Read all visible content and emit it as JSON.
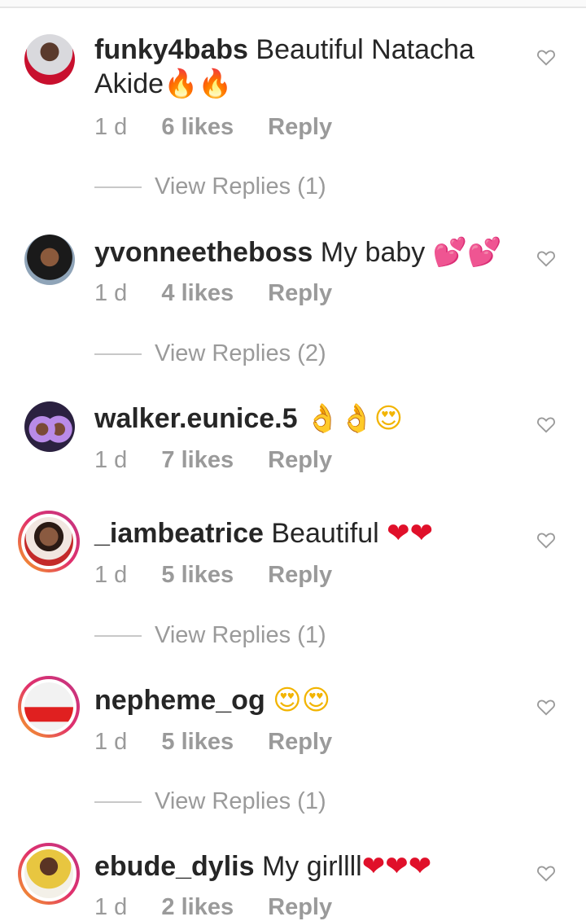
{
  "comments": [
    {
      "user": "funky4babs",
      "text": "Beautiful Natacha Akide",
      "emoji": "🔥🔥",
      "time": "1 d",
      "likes": "6 likes",
      "reply": "Reply",
      "replies": "View Replies (1)"
    },
    {
      "user": "yvonneetheboss",
      "text": "My baby",
      "emoji": "💕💕",
      "time": "1 d",
      "likes": "4 likes",
      "reply": "Reply",
      "replies": "View Replies (2)"
    },
    {
      "user": "walker.eunice.5",
      "text": "",
      "emoji": "👌👌😍",
      "time": "1 d",
      "likes": "7 likes",
      "reply": "Reply",
      "replies": ""
    },
    {
      "user": "_iambeatrice",
      "text": "Beautiful",
      "emoji": "❤❤",
      "time": "1 d",
      "likes": "5 likes",
      "reply": "Reply",
      "replies": "View Replies (1)"
    },
    {
      "user": "nepheme_og",
      "text": "",
      "emoji": "😍😍",
      "time": "1 d",
      "likes": "5 likes",
      "reply": "Reply",
      "replies": "View Replies (1)"
    },
    {
      "user": "ebude_dylis",
      "text": "My girllll",
      "emoji": "❤❤❤",
      "time": "1 d",
      "likes": "2 likes",
      "reply": "Reply",
      "replies": ""
    }
  ],
  "colors": {
    "text": "#262626",
    "meta": "#9a9a9a",
    "story_ring_start": "#f6a623",
    "story_ring_end": "#c13584"
  },
  "icons": {
    "like": "heart-outline-icon"
  }
}
